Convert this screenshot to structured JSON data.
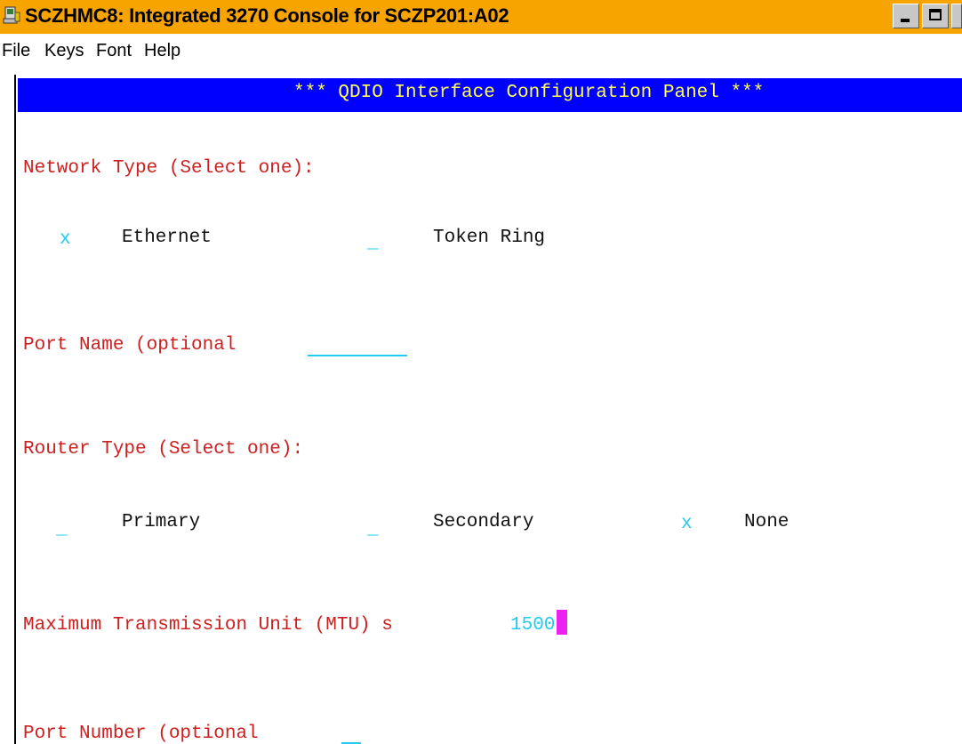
{
  "window": {
    "title": "SCZHMC8: Integrated 3270 Console for SCZP201:A02"
  },
  "menu": {
    "items": [
      "File",
      "Keys",
      "Font",
      "Help"
    ]
  },
  "panel": {
    "header": "*** QDIO Interface Configuration Panel ***",
    "network_type": {
      "label": "Network Type (Select one):",
      "options": [
        {
          "mark": "x",
          "label": "Ethernet"
        },
        {
          "mark": "_",
          "label": "Token Ring"
        }
      ]
    },
    "port_name": {
      "label": "Port Name (optional",
      "value": ""
    },
    "router_type": {
      "label": "Router Type (Select one):",
      "options": [
        {
          "mark": "_",
          "label": "Primary"
        },
        {
          "mark": "_",
          "label": "Secondary"
        },
        {
          "mark": "x",
          "label": "None"
        }
      ]
    },
    "mtu": {
      "label": "Maximum Transmission Unit (MTU) s",
      "value": "1500"
    },
    "port_number": {
      "label": "Port Number (optional",
      "value": ""
    }
  },
  "colors": {
    "title_bar": "#f7a300",
    "header_bar": "#0000ff",
    "header_text": "#ffff55",
    "label_text": "#cc2020",
    "input_text": "#22ccee",
    "cursor": "#ee22ee"
  }
}
